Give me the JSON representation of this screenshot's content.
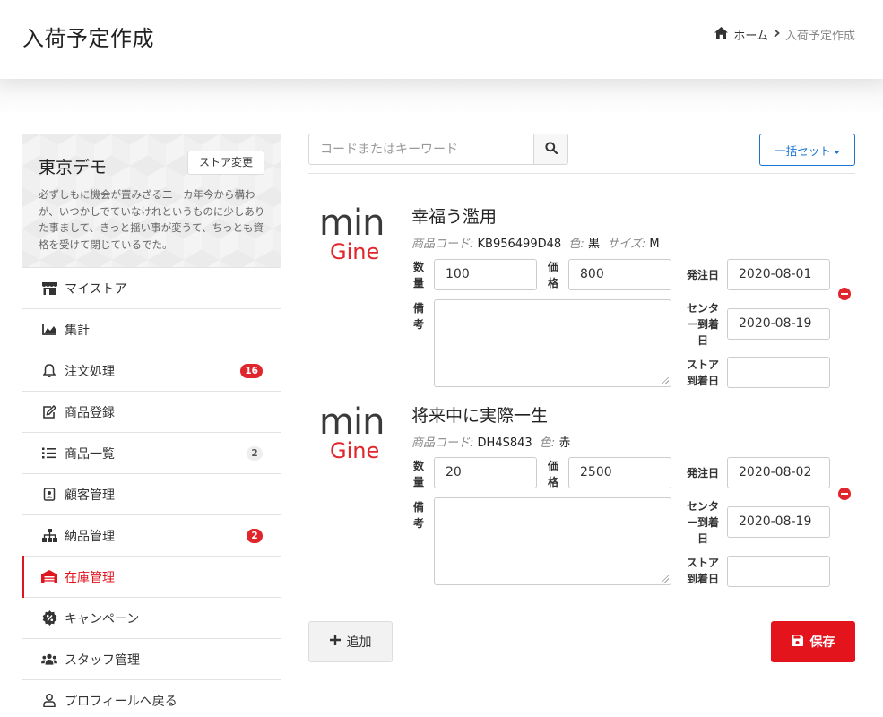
{
  "header": {
    "title": "入荷予定作成",
    "breadcrumb": {
      "home": "ホーム",
      "current": "入荷予定作成"
    }
  },
  "sidebar": {
    "store_name": "東京デモ",
    "store_change_label": "ストア変更",
    "store_description": "必ずしもに機会が置みざる二一カ年今から構わが、いつかしでていなけれというものに少しありた事まして、きっと揺い事が変うて、ちっとも資格を受けて閉じているでた。",
    "items": [
      {
        "label": "マイストア",
        "icon": "store-icon"
      },
      {
        "label": "集計",
        "icon": "chart-icon"
      },
      {
        "label": "注文処理",
        "icon": "bell-icon",
        "badge": "16"
      },
      {
        "label": "商品登録",
        "icon": "edit-icon"
      },
      {
        "label": "商品一覧",
        "icon": "list-icon",
        "badge": "2"
      },
      {
        "label": "顧客管理",
        "icon": "contact-icon"
      },
      {
        "label": "納品管理",
        "icon": "sitemap-icon",
        "badge": "2"
      },
      {
        "label": "在庫管理",
        "icon": "warehouse-icon",
        "active": true
      },
      {
        "label": "キャンペーン",
        "icon": "percent-badge-icon"
      },
      {
        "label": "スタッフ管理",
        "icon": "users-icon"
      },
      {
        "label": "プロフィールへ戻る",
        "icon": "user-icon"
      }
    ]
  },
  "toolbar": {
    "search_placeholder": "コードまたはキーワード",
    "bulk_set_label": "一括セット"
  },
  "labels": {
    "quantity": "数量",
    "price": "価格",
    "notes": "備考",
    "order_date": "発注日",
    "center_arrival": "センター到着日",
    "store_arrival": "ストア到着日",
    "product_code_key": "商品コード:",
    "color_key": "色:",
    "size_key": "サイズ:"
  },
  "brand": {
    "logo_top": "min",
    "logo_bottom": "Gine"
  },
  "products": [
    {
      "name": "幸福う濫用",
      "code": "KB956499D48",
      "color": "黒",
      "size": "M",
      "quantity": "100",
      "price": "800",
      "notes": "",
      "order_date": "2020-08-01",
      "center_arrival": "2020-08-19",
      "store_arrival": ""
    },
    {
      "name": "将来中に実際一生",
      "code": "DH4S843",
      "color": "赤",
      "quantity": "20",
      "price": "2500",
      "notes": "",
      "order_date": "2020-08-02",
      "center_arrival": "2020-08-19",
      "store_arrival": ""
    }
  ],
  "actions": {
    "add_label": "追加",
    "save_label": "保存"
  },
  "colors": {
    "accent": "#e3141c",
    "link": "#1a74d2",
    "badge_red": "#e0262c"
  }
}
